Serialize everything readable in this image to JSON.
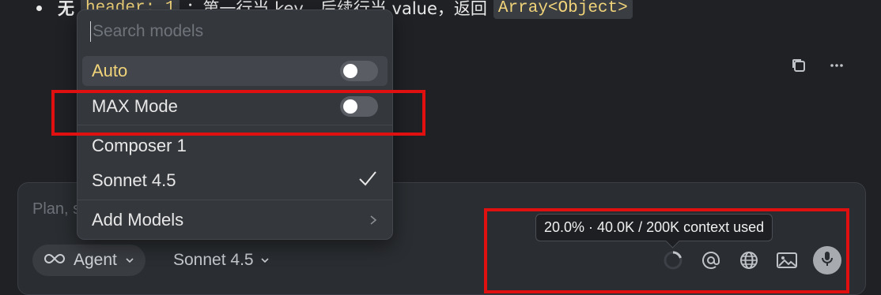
{
  "background_text": {
    "prefix": "无",
    "code1": "header: 1",
    "middle": "：第一行当 key，后续行当 value，返回",
    "code2": "Array<Object>"
  },
  "top_actions": {
    "copy_icon": "copy-icon",
    "more_icon": "ellipsis-icon"
  },
  "composer": {
    "placeholder": "Plan, search, build anything",
    "agent_label": "Agent",
    "model_label": "Sonnet 4.5"
  },
  "tooltip": {
    "text": "20.0% · 40.0K / 200K context used"
  },
  "dropdown": {
    "search_placeholder": "Search models",
    "items": [
      {
        "label": "Auto",
        "toggle": false
      },
      {
        "label": "MAX Mode",
        "toggle": false
      },
      {
        "label": "Composer 1"
      },
      {
        "label": "Sonnet 4.5",
        "selected": true
      },
      {
        "label": "Add Models"
      }
    ]
  },
  "colors": {
    "accent_yellow": "#f1d47a",
    "annotation_red": "#e01010"
  }
}
